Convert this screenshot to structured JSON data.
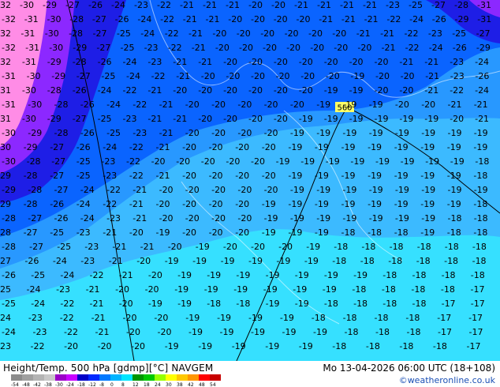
{
  "header": {
    "title": "Height/Temp. 500 hPa [gdmp][°C] NAVGEM",
    "datetime": "Mo 13-04-2026 06:00 UTC (18+108)",
    "credit": "©weatheronline.co.uk"
  },
  "colorbar": {
    "ticks": [
      "-54",
      "-48",
      "-42",
      "-38",
      "-30",
      "-24",
      "-18",
      "-12",
      "-8",
      "0",
      "8",
      "12",
      "18",
      "24",
      "30",
      "38",
      "42",
      "48",
      "54"
    ],
    "colors": [
      "#8c8c8c",
      "#a0a0a0",
      "#b4b4b4",
      "#c8c8c8",
      "#9b00c8",
      "#c800ff",
      "#0000c8",
      "#0028ff",
      "#0078ff",
      "#00b4ff",
      "#00e6ff",
      "#009600",
      "#00c800",
      "#96ff00",
      "#ffff00",
      "#ffc800",
      "#ff9600",
      "#ff0000",
      "#c80000"
    ]
  },
  "map": {
    "colors": {
      "pink": "#ff8ce6",
      "violet": "#8c28ff",
      "navy": "#1e1ee6",
      "blue": "#0a64ff",
      "skyblue": "#2898ff",
      "lightblue": "#3cbaff",
      "cyan": "#36e0ff"
    },
    "contour_label": "560",
    "temperature_rows": [
      "-32 -30 -29 -27 -26 -24 -23 -22 -21 -21 -21 -20 -20 -21 -21 -21 -21 -23 -25 -27 -28 -31",
      "-32 -31 -30 -28 -27 -26 -24 -22 -21 -21 -20 -20 -20 -20 -21 -21 -21 -22 -24 -26 -29 -31",
      "-32 -31 -30 -28 -27 -25 -24 -22 -21 -20 -20 -20 -20 -20 -20 -21 -21 -22 -23 -25 -27",
      "-32 -31 -30 -29 -27 -25 -23 -22 -21 -20 -20 -20 -20 -20 -20 -20 -21 -22 -24 -26 -29",
      "-32 -31 -29 -28 -26 -24 -23 -21 -21 -20 -20 -20 -20 -20 -20 -20 -21 -21 -23 -24",
      "-31 -30 -29 -27 -25 -24 -22 -21 -20 -20 -20 -20 -20 -20 -19 -20 -20 -21 -23 -26",
      "-31 -30 -28 -26 -24 -22 -21 -20 -20 -20 -20 -20 -20 -19 -19 -20 -20 -21 -22 -24",
      "-31 -30 -28 -26 -24 -22 -21 -20 -20 -20 -20 -20 -19 -19 -19 -20 -20 -21 -21",
      "-31 -30 -29 -27 -25 -23 -21 -21 -20 -20 -20 -20 -19 -19 -19 -19 -19 -19 -20 -21",
      "-30 -29 -28 -26 -25 -23 -21 -20 -20 -20 -20 -19 -19 -19 -19 -19 -19 -19 -19",
      "-30 -29 -27 -26 -24 -22 -21 -20 -20 -20 -20 -19 -19 -19 -19 -19 -19 -19 -19",
      "-30 -28 -27 -25 -23 -22 -20 -20 -20 -20 -20 -19 -19 -19 -19 -19 -19 -19 -19 -18",
      "-29 -28 -27 -25 -23 -22 -21 -20 -20 -20 -20 -19 -19 -19 -19 -19 -19 -19 -18",
      "-29 -28 -27 -24 -22 -21 -20 -20 -20 -20 -20 -19 -19 -19 -19 -19 -19 -19 -19",
      "-29 -28 -26 -24 -22 -21 -20 -20 -20 -20 -19 -19 -19 -19 -19 -19 -19 -19 -18",
      "-28 -27 -26 -24 -23 -21 -20 -20 -20 -20 -19 -19 -19 -19 -19 -19 -19 -18 -18",
      "-28 -27 -25 -23 -21 -20 -19 -20 -20 -20 -19 -19 -19 -18 -18 -18 -19 -18 -18",
      "-28 -27 -25 -23 -21 -21 -20 -19 -20 -20 -20 -19 -18 -18 -18 -18 -18 -18",
      "-27 -26 -24 -23 -21 -20 -19 -19 -19 -19 -19 -19 -18 -18 -18 -18 -18 -18",
      "-26 -25 -24 -22 -21 -20 -19 -19 -19 -19 -19 -19 -19 -18 -18 -18 -18",
      "-25 -24 -23 -21 -20 -20 -19 -19 -19 -19 -19 -19 -18 -18 -18 -18 -17",
      "-25 -24 -22 -21 -20 -19 -19 -18 -18 -19 -19 -18 -18 -18 -18 -17 -17",
      "-24 -23 -22 -21 -20 -20 -19 -19 -19 -19 -18 -18 -18 -18 -17 -17",
      "-24 -23 -22 -21 -20 -20 -19 -19 -19 -19 -19 -18 -18 -18 -17 -17",
      "-23 -22 -20 -20 -20 -19 -19 -19 -19 -19 -18 -18 -18 -18 -17"
    ]
  }
}
